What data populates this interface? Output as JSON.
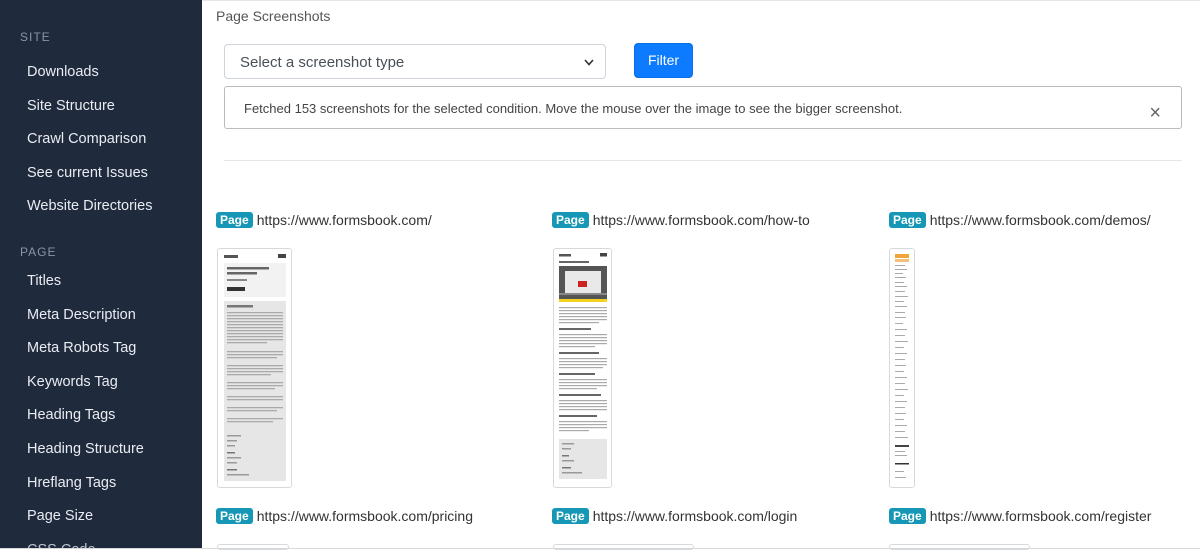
{
  "sidebar": {
    "sections": [
      {
        "title": "SITE",
        "items": [
          "Downloads",
          "Site Structure",
          "Crawl Comparison",
          "See current Issues",
          "Website Directories"
        ]
      },
      {
        "title": "PAGE",
        "items": [
          "Titles",
          "Meta Description",
          "Meta Robots Tag",
          "Keywords Tag",
          "Heading Tags",
          "Heading Structure",
          "Hreflang Tags",
          "Page Size",
          "CSS Code"
        ]
      }
    ]
  },
  "main": {
    "title": "Page Screenshots",
    "select_value": "Select a screenshot type",
    "filter_label": "Filter",
    "alert_text": "Fetched 153 screenshots for the selected condition. Move the mouse over the image to see the bigger screenshot.",
    "close_symbol": "×",
    "badge_label": "Page"
  },
  "screenshots": [
    {
      "url": "https://www.formsbook.com/"
    },
    {
      "url": "https://www.formsbook.com/how-to"
    },
    {
      "url": "https://www.formsbook.com/demos/"
    },
    {
      "url": "https://www.formsbook.com/pricing"
    },
    {
      "url": "https://www.formsbook.com/login"
    },
    {
      "url": "https://www.formsbook.com/register"
    }
  ],
  "colors": {
    "sidebar_bg": "#1f2a3c",
    "primary_button": "#0d7bff",
    "badge": "#1597b5"
  }
}
